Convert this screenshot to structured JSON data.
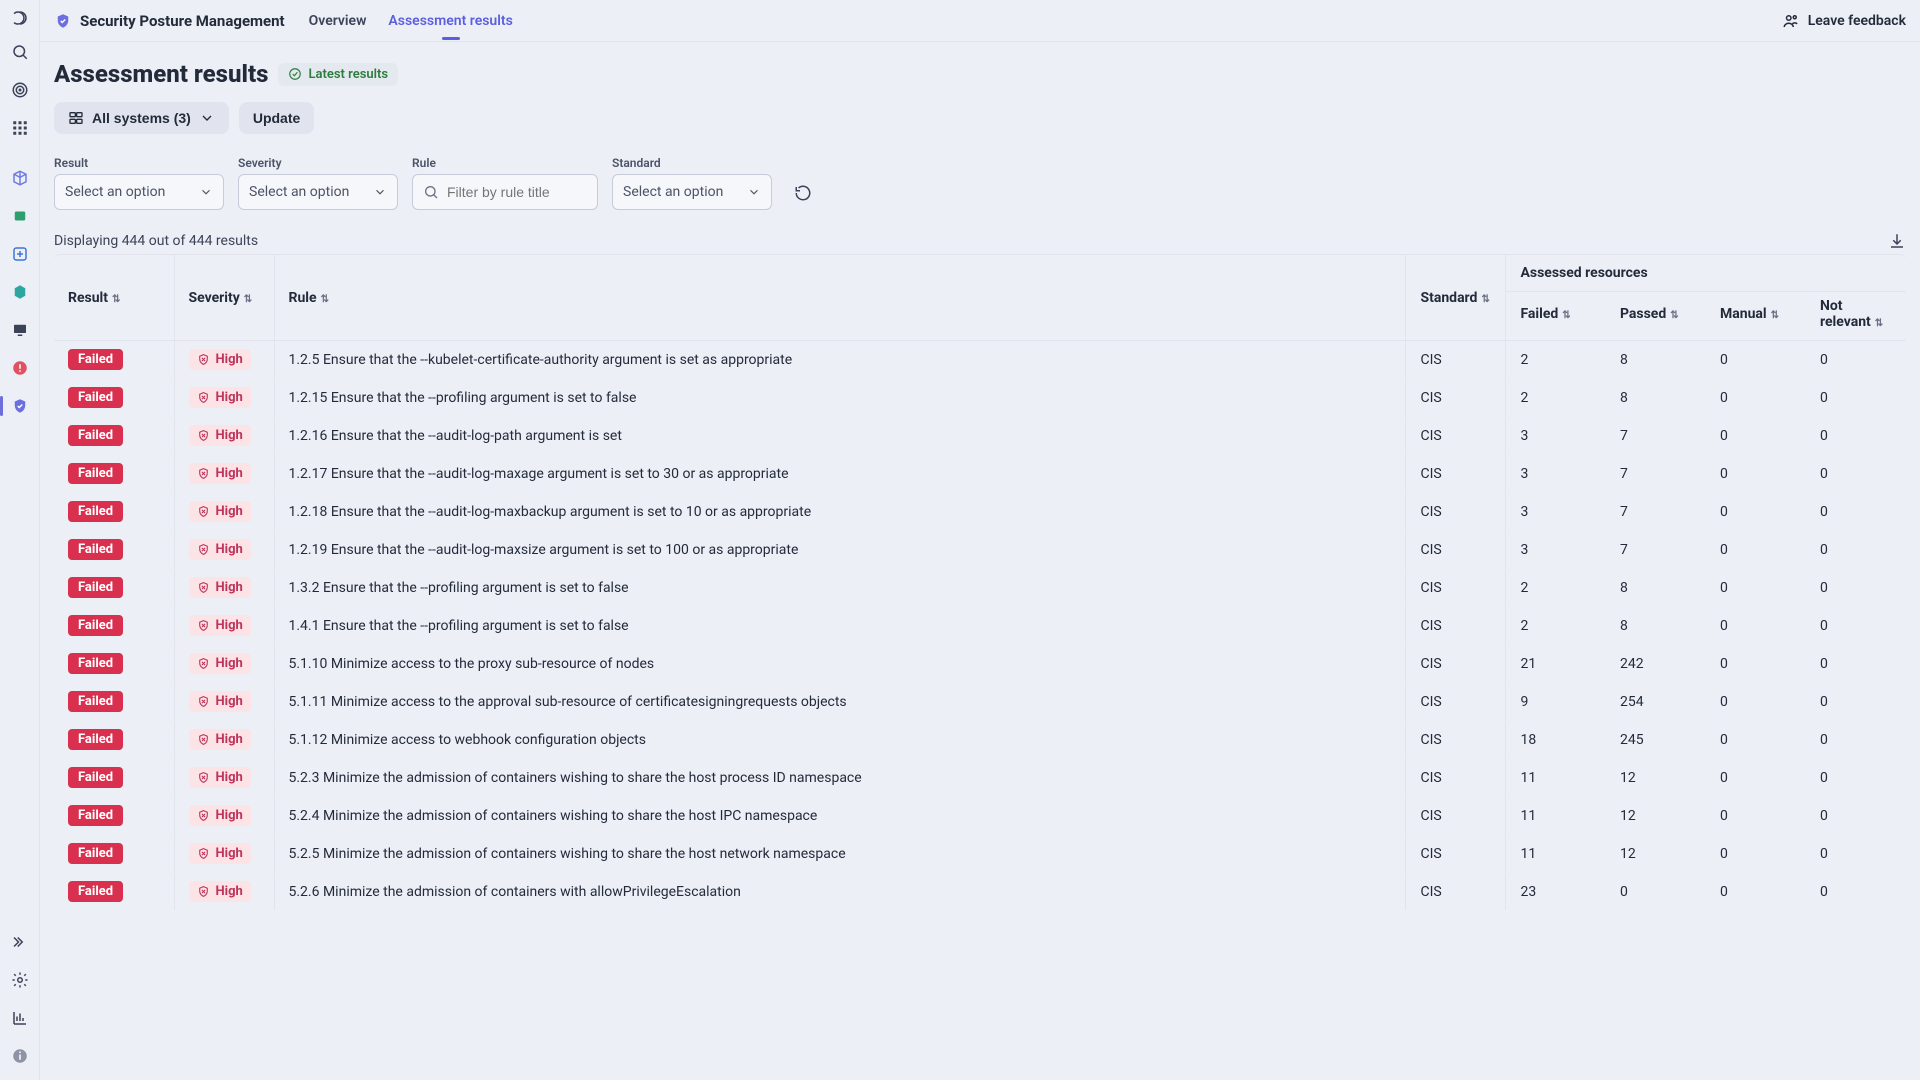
{
  "header": {
    "app_title": "Security Posture Management",
    "tabs": [
      {
        "label": "Overview",
        "active": false
      },
      {
        "label": "Assessment results",
        "active": true
      }
    ],
    "feedback_label": "Leave feedback"
  },
  "page": {
    "title": "Assessment results",
    "latest_chip": "Latest results",
    "systems_button": "All systems (3)",
    "update_button": "Update",
    "result_count": "Displaying 444 out of 444 results"
  },
  "filters": {
    "result": {
      "label": "Result",
      "placeholder": "Select an option"
    },
    "severity": {
      "label": "Severity",
      "placeholder": "Select an option"
    },
    "rule": {
      "label": "Rule",
      "placeholder": "Filter by rule title"
    },
    "standard": {
      "label": "Standard",
      "placeholder": "Select an option"
    }
  },
  "table": {
    "columns": {
      "result": "Result",
      "severity": "Severity",
      "rule": "Rule",
      "standard": "Standard",
      "assessed": "Assessed resources",
      "failed": "Failed",
      "passed": "Passed",
      "manual": "Manual",
      "not_relevant": "Not relevant"
    },
    "rows": [
      {
        "result": "Failed",
        "severity": "High",
        "rule": "1.2.5 Ensure that the --kubelet-certificate-authority argument is set as appropriate",
        "standard": "CIS",
        "failed": 2,
        "passed": 8,
        "manual": 0,
        "not_relevant": 0
      },
      {
        "result": "Failed",
        "severity": "High",
        "rule": "1.2.15 Ensure that the --profiling argument is set to false",
        "standard": "CIS",
        "failed": 2,
        "passed": 8,
        "manual": 0,
        "not_relevant": 0
      },
      {
        "result": "Failed",
        "severity": "High",
        "rule": "1.2.16 Ensure that the --audit-log-path argument is set",
        "standard": "CIS",
        "failed": 3,
        "passed": 7,
        "manual": 0,
        "not_relevant": 0
      },
      {
        "result": "Failed",
        "severity": "High",
        "rule": "1.2.17 Ensure that the --audit-log-maxage argument is set to 30 or as appropriate",
        "standard": "CIS",
        "failed": 3,
        "passed": 7,
        "manual": 0,
        "not_relevant": 0
      },
      {
        "result": "Failed",
        "severity": "High",
        "rule": "1.2.18 Ensure that the --audit-log-maxbackup argument is set to 10 or as appropriate",
        "standard": "CIS",
        "failed": 3,
        "passed": 7,
        "manual": 0,
        "not_relevant": 0
      },
      {
        "result": "Failed",
        "severity": "High",
        "rule": "1.2.19 Ensure that the --audit-log-maxsize argument is set to 100 or as appropriate",
        "standard": "CIS",
        "failed": 3,
        "passed": 7,
        "manual": 0,
        "not_relevant": 0
      },
      {
        "result": "Failed",
        "severity": "High",
        "rule": "1.3.2 Ensure that the --profiling argument is set to false",
        "standard": "CIS",
        "failed": 2,
        "passed": 8,
        "manual": 0,
        "not_relevant": 0
      },
      {
        "result": "Failed",
        "severity": "High",
        "rule": "1.4.1 Ensure that the --profiling argument is set to false",
        "standard": "CIS",
        "failed": 2,
        "passed": 8,
        "manual": 0,
        "not_relevant": 0
      },
      {
        "result": "Failed",
        "severity": "High",
        "rule": "5.1.10 Minimize access to the proxy sub-resource of nodes",
        "standard": "CIS",
        "failed": 21,
        "passed": 242,
        "manual": 0,
        "not_relevant": 0
      },
      {
        "result": "Failed",
        "severity": "High",
        "rule": "5.1.11 Minimize access to the approval sub-resource of certificatesigningrequests objects",
        "standard": "CIS",
        "failed": 9,
        "passed": 254,
        "manual": 0,
        "not_relevant": 0
      },
      {
        "result": "Failed",
        "severity": "High",
        "rule": "5.1.12 Minimize access to webhook configuration objects",
        "standard": "CIS",
        "failed": 18,
        "passed": 245,
        "manual": 0,
        "not_relevant": 0
      },
      {
        "result": "Failed",
        "severity": "High",
        "rule": "5.2.3 Minimize the admission of containers wishing to share the host process ID namespace",
        "standard": "CIS",
        "failed": 11,
        "passed": 12,
        "manual": 0,
        "not_relevant": 0
      },
      {
        "result": "Failed",
        "severity": "High",
        "rule": "5.2.4 Minimize the admission of containers wishing to share the host IPC namespace",
        "standard": "CIS",
        "failed": 11,
        "passed": 12,
        "manual": 0,
        "not_relevant": 0
      },
      {
        "result": "Failed",
        "severity": "High",
        "rule": "5.2.5 Minimize the admission of containers wishing to share the host network namespace",
        "standard": "CIS",
        "failed": 11,
        "passed": 12,
        "manual": 0,
        "not_relevant": 0
      },
      {
        "result": "Failed",
        "severity": "High",
        "rule": "5.2.6 Minimize the admission of containers with allowPrivilegeEscalation",
        "standard": "CIS",
        "failed": 23,
        "passed": 0,
        "manual": 0,
        "not_relevant": 0
      }
    ]
  }
}
